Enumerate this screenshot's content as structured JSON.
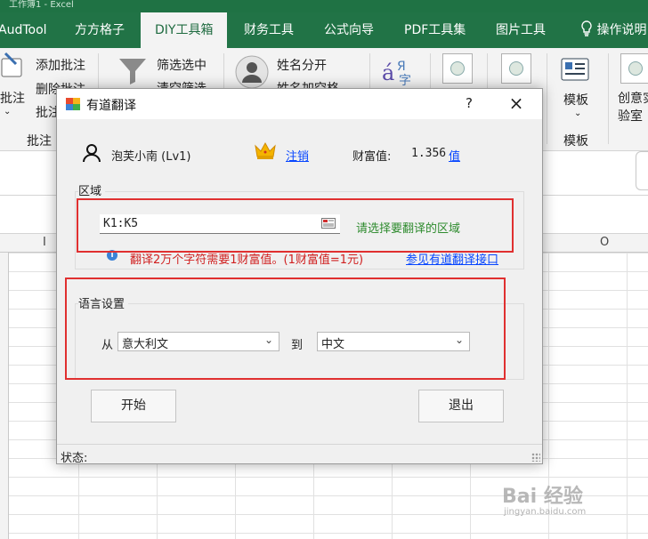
{
  "excel": {
    "topbar_text": "工作簿1 - Excel",
    "tabs": [
      "AudTool",
      "方方格子",
      "DIY工具箱",
      "财务工具",
      "公式向导",
      "PDF工具集",
      "图片工具",
      "操作说明"
    ],
    "active_tab_index": 2,
    "ribbon": {
      "comment_btn": "批注",
      "add_comment": "添加批注",
      "delete_comment": "删除批注",
      "comment_more": "批注",
      "group_comment": "批注",
      "filter_selected": "筛选选中",
      "clear_filter": "清空筛选",
      "name_split": "姓名分开",
      "name_space": "姓名加空格",
      "template_btn": "模板",
      "group_template": "模板",
      "lab_line1": "创意实",
      "lab_line2": "验室"
    },
    "column_letters": [
      "I",
      "O"
    ]
  },
  "dialog": {
    "title": "有道翻译",
    "help": "?",
    "close": "×",
    "user_name": "泡芙小南 (Lv1)",
    "logout": "注销",
    "wealth_label": "财富值:",
    "wealth_value": "1.356",
    "wealth_link": "值",
    "region_label": "区域",
    "range_value": "K1:K5",
    "region_hint": "请选择要翻译的区域",
    "cost_note": "翻译2万个字符需要1财富值。(1财富值=1元)",
    "api_link": "参见有道翻译接口",
    "lang_label": "语言设置",
    "from_label": "从",
    "from_value": "意大利文",
    "to_label": "到",
    "to_value": "中文",
    "start": "开始",
    "exit": "退出",
    "status_label": "状态:"
  },
  "watermark": {
    "brand": "Bai  经验",
    "url": "jingyan.baidu.com"
  },
  "colors": {
    "excel_green": "#217346",
    "annotation_red": "#e03030",
    "link_blue": "#0645ff",
    "hint_green": "#2e8b2e",
    "note_red": "#d02020"
  }
}
